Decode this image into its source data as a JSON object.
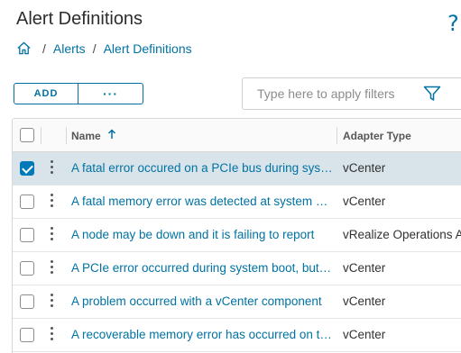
{
  "page": {
    "title": "Alert Definitions",
    "help_icon": "?"
  },
  "breadcrumb": {
    "home_icon": "home-icon",
    "items": [
      "Alerts",
      "Alert Definitions"
    ],
    "separator": "/"
  },
  "toolbar": {
    "add_label": "ADD",
    "more_label": "···"
  },
  "filter": {
    "placeholder": "Type here to apply filters",
    "icon": "funnel-icon"
  },
  "grid": {
    "columns": {
      "name": "Name",
      "adapter_type": "Adapter Type",
      "sort_icon": "arrow-up-icon"
    },
    "rows": [
      {
        "name": "A fatal error occured on a PCIe bus during system boot",
        "adapter_type": "vCenter",
        "selected": true
      },
      {
        "name": "A fatal memory error was detected at system boot",
        "adapter_type": "vCenter",
        "selected": false
      },
      {
        "name": "A node may be down and it is failing to report",
        "adapter_type": "vRealize Operations Adapter",
        "selected": false
      },
      {
        "name": "A PCIe error occurred during system boot, but the error is recoverable",
        "adapter_type": "vCenter",
        "selected": false
      },
      {
        "name": "A problem occurred with a vCenter component",
        "adapter_type": "vCenter",
        "selected": false
      },
      {
        "name": "A recoverable memory error has occurred on the host",
        "adapter_type": "vCenter",
        "selected": false
      }
    ]
  },
  "colors": {
    "accent": "#0072a3",
    "selected_row": "#d9e4ea",
    "checkbox_checked": "#0079b8"
  }
}
